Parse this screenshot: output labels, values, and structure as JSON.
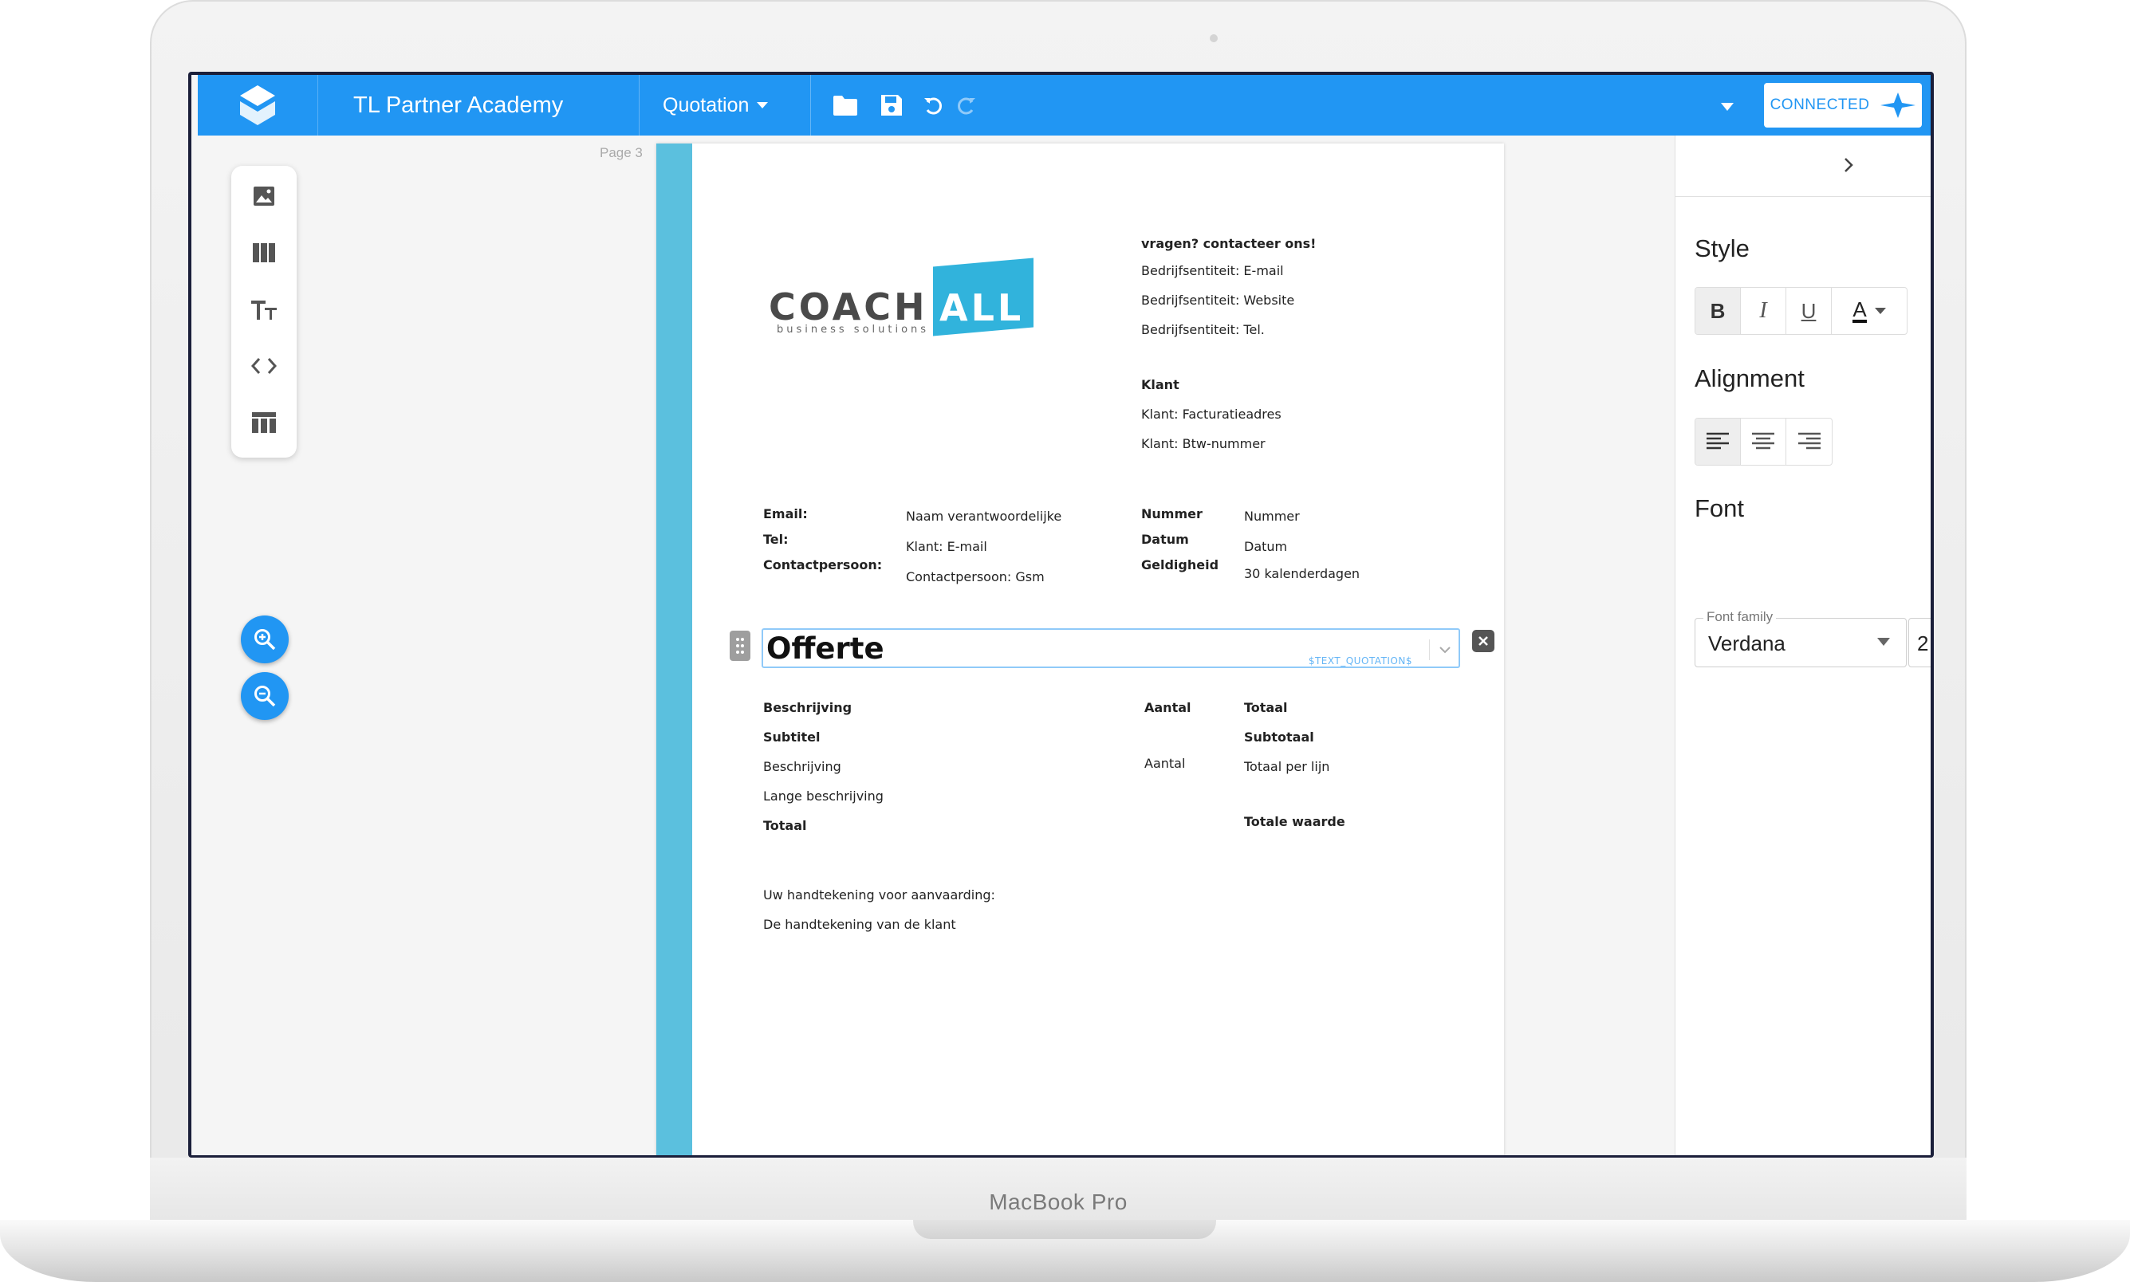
{
  "device": {
    "brand_label": "MacBook Pro"
  },
  "app": {
    "title": "TL Partner Academy",
    "accent_color": "#2196f3",
    "doc_type": "Quotation",
    "toolbar_icons": [
      "folder-icon",
      "save-icon",
      "undo-icon",
      "redo-icon"
    ],
    "status": "CONNECTED"
  },
  "left_toolbar": {
    "tools": [
      "image-icon",
      "columns-icon",
      "text-icon",
      "code-icon",
      "table-icon"
    ],
    "zoom": [
      "zoom-in-icon",
      "zoom-out-icon"
    ]
  },
  "page": {
    "label": "Page 3",
    "band_color": "#5bc0de",
    "logo": {
      "main": "COACH",
      "highlight": "ALL",
      "tagline": "business solutions"
    },
    "contact": {
      "heading": "vragen? contacteer ons!",
      "lines": [
        "Bedrijfsentiteit: E-mail",
        "Bedrijfsentiteit: Website",
        "Bedrijfsentiteit: Tel."
      ]
    },
    "klant": {
      "heading": "Klant",
      "lines": [
        "Klant: Facturatieadres",
        "Klant: Btw-nummer"
      ]
    },
    "info_left": {
      "labels": [
        "Email:",
        "Tel:",
        "Contactpersoon:"
      ],
      "values": [
        "Naam verantwoordelijke",
        "Klant: E-mail",
        "Contactpersoon: Gsm"
      ]
    },
    "info_right": {
      "labels": [
        "Nummer",
        "Datum",
        "Geldigheid"
      ],
      "values": [
        "Nummer",
        "Datum",
        "30 kalenderdagen"
      ]
    },
    "offerte": {
      "title": "Offerte",
      "tag": "$TEXT_QUOTATION$"
    },
    "table": {
      "headers": [
        "Beschrijving",
        "Aantal",
        "Totaal"
      ],
      "subtitle": "Subtitel",
      "subtotal": "Subtotaal",
      "row": [
        "Beschrijving",
        "Aantal",
        "Totaal per lijn"
      ],
      "long_description": "Lange beschrijving",
      "total_label": "Totaal",
      "total_value": "Totale waarde"
    },
    "signature": {
      "prompt": "Uw handtekening voor aanvaarding:",
      "line": "De handtekening van de klant"
    }
  },
  "right_panel": {
    "style_title": "Style",
    "style_buttons": [
      "B",
      "I",
      "U",
      "A"
    ],
    "alignment_title": "Alignment",
    "alignment_buttons": [
      "align-left-icon",
      "align-center-icon",
      "align-right-icon"
    ],
    "font_title": "Font",
    "font_family_label": "Font family",
    "font_family_value": "Verdana",
    "font_size_value": "2"
  }
}
